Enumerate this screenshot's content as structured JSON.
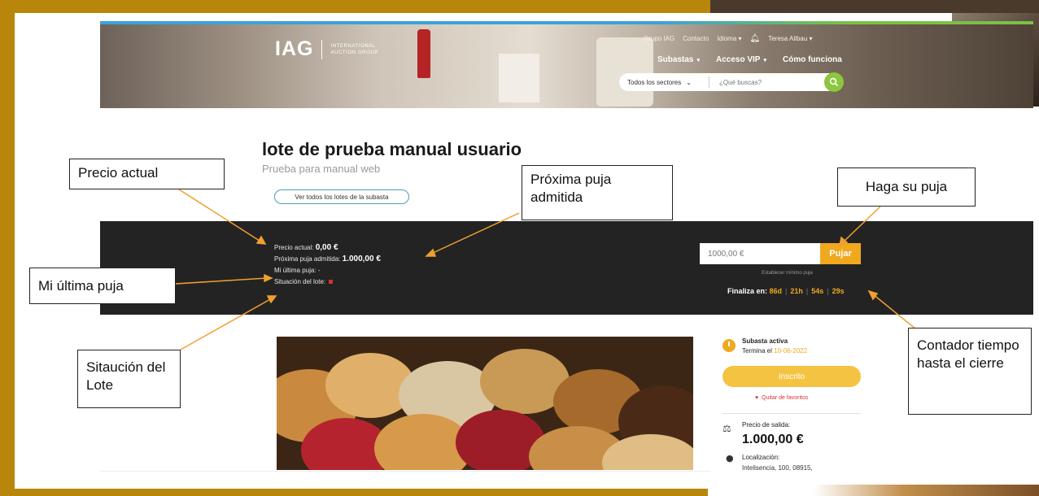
{
  "header": {
    "logo": "IAG",
    "logo_sub_line1": "International",
    "logo_sub_line2": "Auction Group",
    "topnav": [
      "Grupo IAG",
      "Contacto",
      "Idioma ▾",
      "Teresa Alibau ▾"
    ],
    "mainnav": [
      "Subastas",
      "Acceso VIP",
      "Cómo funciona"
    ],
    "sector_select": "Todos los sectores",
    "search_placeholder": "¿Qué buscas?"
  },
  "lot": {
    "title": "lote de prueba manual usuario",
    "subtitle": "Prueba para manual web",
    "all_lots_button": "Ver todos los lotes de la subasta"
  },
  "bid_band": {
    "current_price_label": "Precio actual:",
    "current_price_value": "0,00 €",
    "next_bid_label": "Próxima puja admitida:",
    "next_bid_value": "1.000,00 €",
    "last_bid_label": "Mi última puja:",
    "last_bid_value": "-",
    "status_label": "Situación del lote:",
    "bid_input_value": "1000,00 €",
    "bid_button": "Pujar",
    "min_bid_link": "Establecer mínimo puja",
    "countdown_label": "Finaliza en:",
    "countdown": [
      "86d",
      "21h",
      "54s",
      "29s"
    ]
  },
  "panel": {
    "status": "Subasta activa",
    "ends_label": "Termina el",
    "ends_date": "10-06-2022",
    "registered_button": "Inscrito",
    "favorites_link": "Quitar de favoritos",
    "start_price_label": "Precio de salida:",
    "start_price_value": "1.000,00 €",
    "location_label": "Localización:",
    "location_value": "Intelisencia, 100, 08915,"
  },
  "callouts": {
    "precio_actual": "Precio actual",
    "proxima_puja": "Próxima puja admitida",
    "haga_puja": "Haga su puja",
    "mi_ultima": "Mi última puja",
    "situacion": "Sitaución del Lote",
    "contador": "Contador tiempo hasta el cierre"
  },
  "colors": {
    "frame": "#b8860b",
    "band": "#232323",
    "accent": "#f0a81f",
    "search_button": "#8dc63f",
    "status_red": "#d83333"
  },
  "icons": [
    "bell-icon",
    "search-icon",
    "clock-icon",
    "heart-icon",
    "gavel-icon",
    "location-pin-icon"
  ]
}
